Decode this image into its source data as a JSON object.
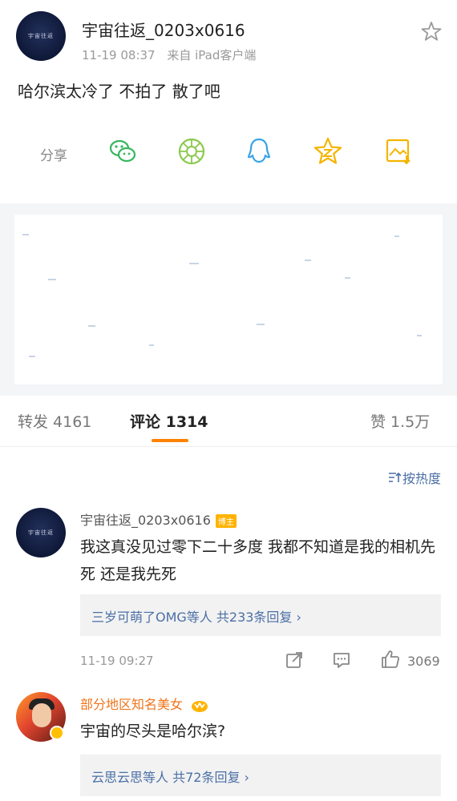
{
  "post": {
    "author": "宇宙往返_0203x0616",
    "time": "11-19 08:37",
    "source": "来自 iPad客户端",
    "text": "哈尔滨太冷了 不拍了 散了吧",
    "avatar_logo": "宇宙往返"
  },
  "share": {
    "label": "分享",
    "icons": [
      "wechat-icon",
      "moments-icon",
      "qq-icon",
      "qzone-icon",
      "save-image-icon"
    ]
  },
  "tabs": {
    "repost": "转发 4161",
    "comment": "评论 1314",
    "like": "赞 1.5万"
  },
  "sort": {
    "label": "按热度"
  },
  "comments": [
    {
      "name": "宇宙往返_0203x0616",
      "badge": "博主",
      "text": "我这真没见过零下二十多度 我都不知道是我的相机先死 还是我先死",
      "reply_summary": "三岁可萌了OMG等人 共233条回复 ›",
      "time": "11-19 09:27",
      "likes": "3069"
    },
    {
      "name": "部分地区知名美女",
      "text": "宇宙的尽头是哈尔滨?",
      "reply_summary": "云思云思等人 共72条回复 ›"
    }
  ],
  "colors": {
    "accent": "#ff8200",
    "link": "#4b6fa6",
    "wechat": "#36b65f",
    "moments": "#8bc94c",
    "qq": "#3aa4e6",
    "qzone": "#f5b400",
    "save": "#f5b400"
  }
}
